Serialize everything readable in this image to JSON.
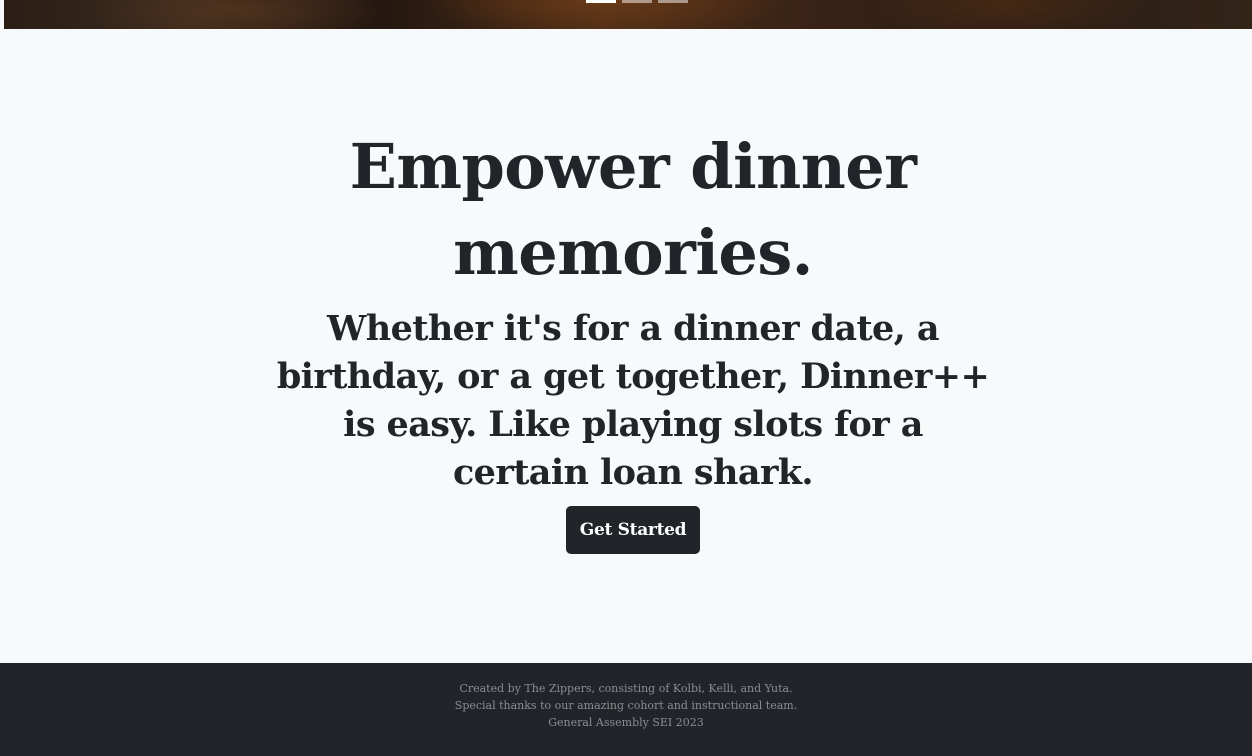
{
  "carousel": {
    "indicators": [
      {
        "label": "Slide 1",
        "active": true
      },
      {
        "label": "Slide 2",
        "active": false
      },
      {
        "label": "Slide 3",
        "active": false
      }
    ]
  },
  "hero": {
    "title": "Empower dinner memories.",
    "subtitle": "Whether it's for a dinner date, a birthday, or a get together, Dinner++ is easy. Like playing slots for a certain loan shark.",
    "cta_label": "Get Started"
  },
  "footer": {
    "lines": [
      "Created by The Zippers, consisting of Kolbi, Kelli, and Yuta.",
      "Special thanks to our amazing cohort and instructional team.",
      "General Assembly SEI 2023"
    ]
  },
  "colors": {
    "page_background": "#f8f9fa",
    "text_dark": "#212529",
    "button_background": "#212529",
    "footer_background": "#212529",
    "footer_text": "#8a8d91"
  }
}
